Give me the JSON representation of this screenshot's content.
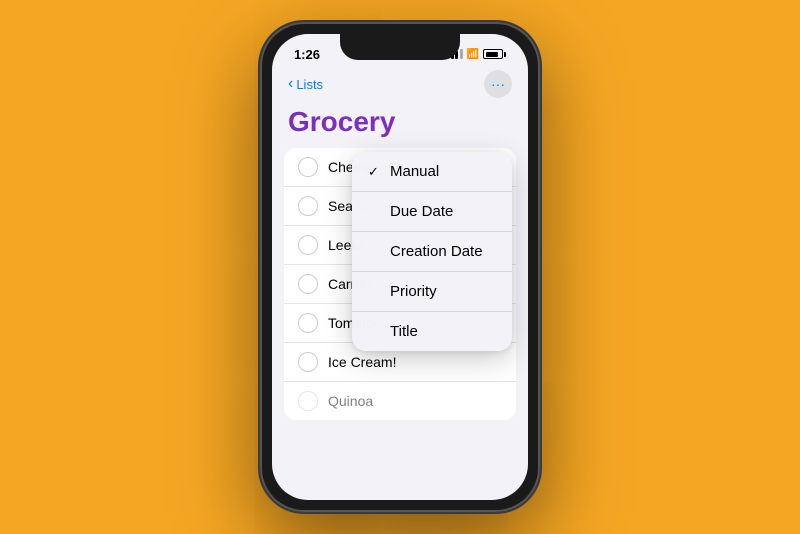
{
  "background_color": "#F5A623",
  "phone": {
    "status_bar": {
      "time": "1:26"
    },
    "nav": {
      "back_label": "Lists",
      "action_icon": "ellipsis-icon"
    },
    "title": "Grocery",
    "list_items": [
      {
        "id": 1,
        "text": "Cheese"
      },
      {
        "id": 2,
        "text": "Sea Salt"
      },
      {
        "id": 3,
        "text": "Leeks"
      },
      {
        "id": 4,
        "text": "Carrots"
      },
      {
        "id": 5,
        "text": "Tomatoes"
      },
      {
        "id": 6,
        "text": "Ice Cream!"
      },
      {
        "id": 7,
        "text": "Quinoa"
      }
    ],
    "dropdown": {
      "items": [
        {
          "id": 1,
          "label": "Manual",
          "checked": true
        },
        {
          "id": 2,
          "label": "Due Date",
          "checked": false
        },
        {
          "id": 3,
          "label": "Creation Date",
          "checked": false
        },
        {
          "id": 4,
          "label": "Priority",
          "checked": false
        },
        {
          "id": 5,
          "label": "Title",
          "checked": false
        }
      ]
    }
  }
}
